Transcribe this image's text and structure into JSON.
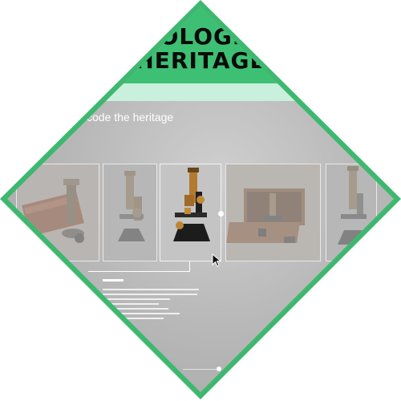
{
  "header": {
    "title_line1": "OLOGI",
    "title_line2": "HERITAGE"
  },
  "section": {
    "subtitle": "code the heritage"
  },
  "carousel": {
    "items": [
      {
        "icon": "microscope-in-box-icon"
      },
      {
        "icon": "brass-microscope-icon"
      },
      {
        "icon": "black-brass-microscope-icon",
        "selected": true
      },
      {
        "icon": "microscope-case-icon"
      },
      {
        "icon": "tall-microscope-icon"
      }
    ]
  },
  "colors": {
    "frame_green": "#3db86f",
    "header_green": "#3ec074",
    "mint": "#c9f0dc"
  }
}
